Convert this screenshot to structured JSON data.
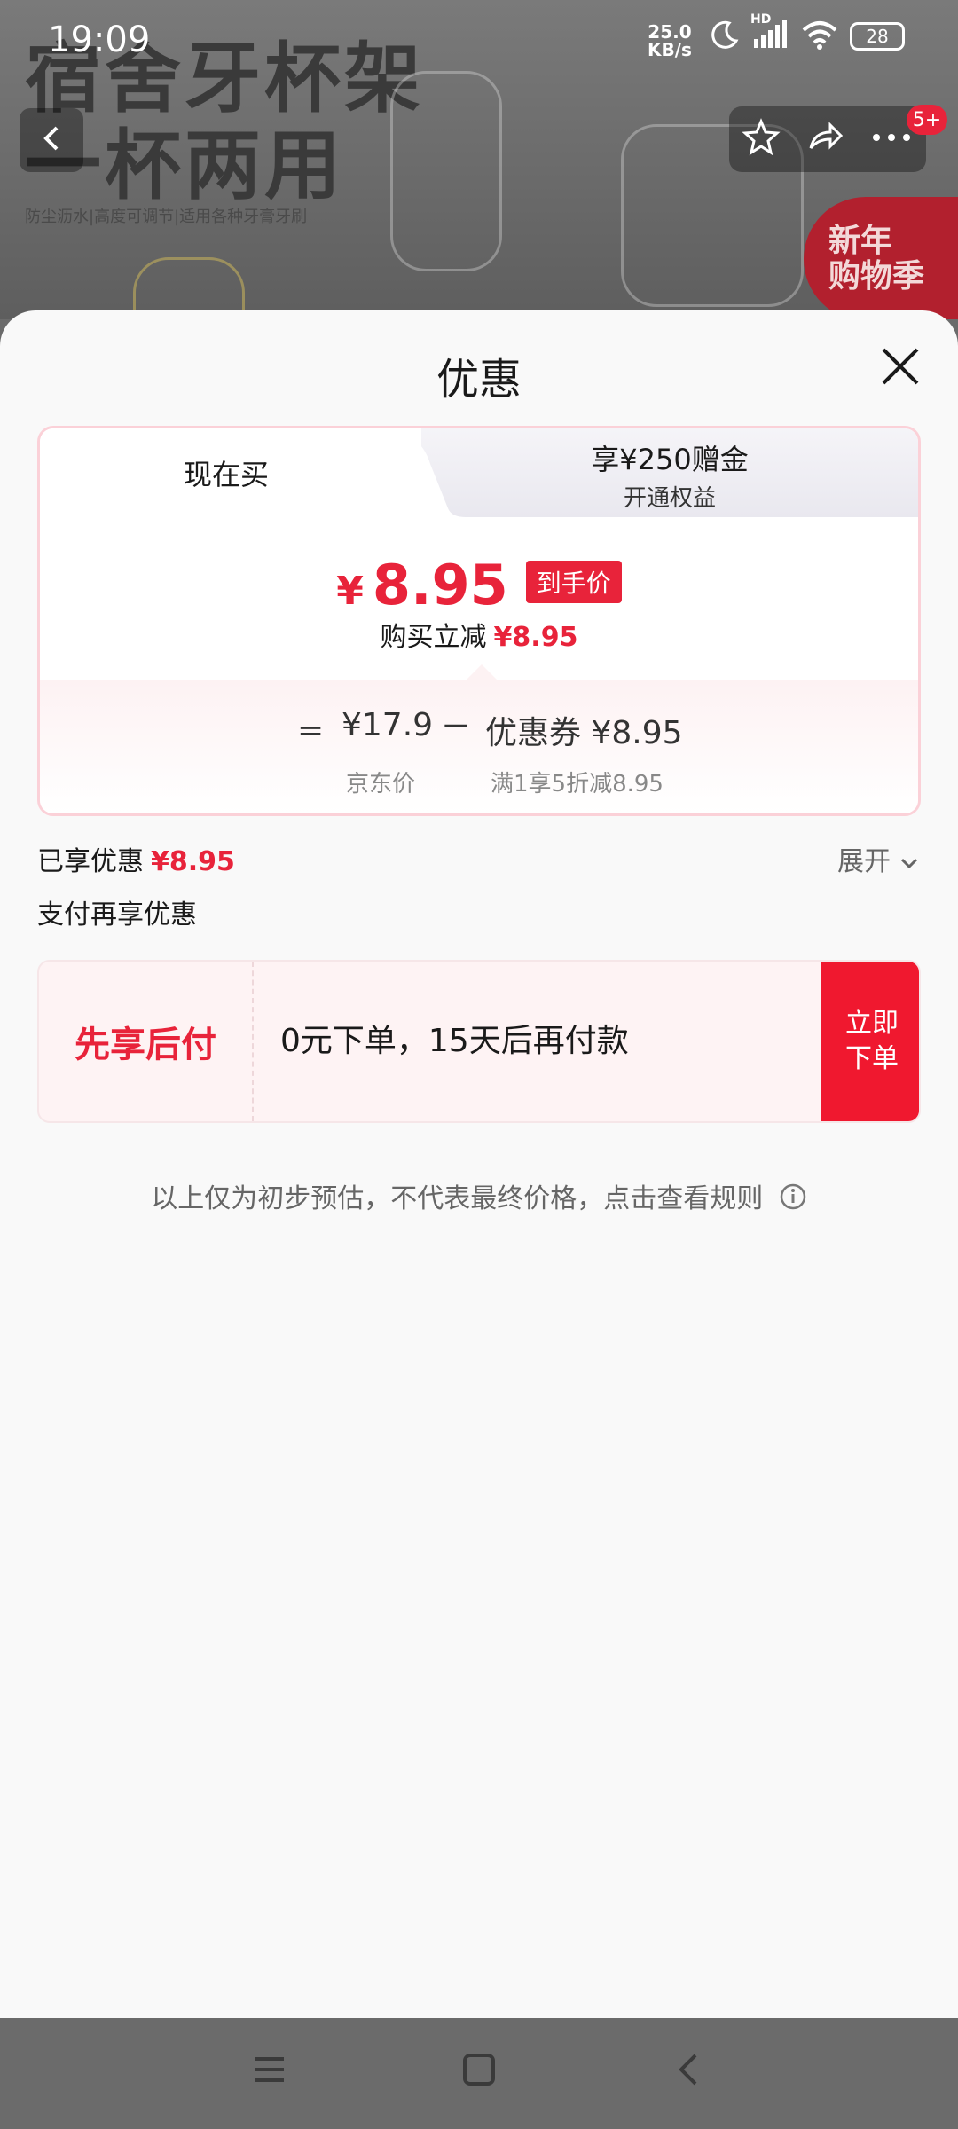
{
  "status_bar": {
    "time": "19:09",
    "net_speed_value": "25.0",
    "net_speed_unit": "KB/s",
    "hd_label": "HD",
    "battery": "28"
  },
  "background": {
    "banner_line1": "宿舍牙杯架",
    "banner_line2": "一杯两用",
    "banner_sub": "防尘沥水|高度可调节|适用各种牙膏牙刷",
    "action_badge": "5+",
    "promo_tag_line1": "新年",
    "promo_tag_line2": "购物季"
  },
  "sheet": {
    "title": "优惠",
    "tabs": [
      {
        "label": "现在买"
      },
      {
        "label": "享¥250赠金",
        "sublabel": "开通权益"
      }
    ],
    "final_price": {
      "currency": "¥",
      "amount": "8.95",
      "tag": "到手价"
    },
    "reduce": {
      "label": "购买立减",
      "value": "¥8.95"
    },
    "breakdown": {
      "eq": "=",
      "jd_price": "¥17.9",
      "jd_price_label": "京东价",
      "minus": "−",
      "coupon": "优惠券 ¥8.95",
      "coupon_label": "满1享5折减8.95"
    },
    "enjoyed": {
      "label": "已享优惠",
      "value": "¥8.95",
      "expand": "展开"
    },
    "pay_section_title": "支付再享优惠",
    "pay_later": {
      "title": "先享后付",
      "desc": "0元下单，15天后再付款",
      "button": "立即下单"
    },
    "note": "以上仅为初步预估，不代表最终价格，点击查看规则"
  },
  "colors": {
    "accent": "#e8233a",
    "sheet_bg": "#f9f9f9",
    "card_border": "#fbd1d8"
  }
}
